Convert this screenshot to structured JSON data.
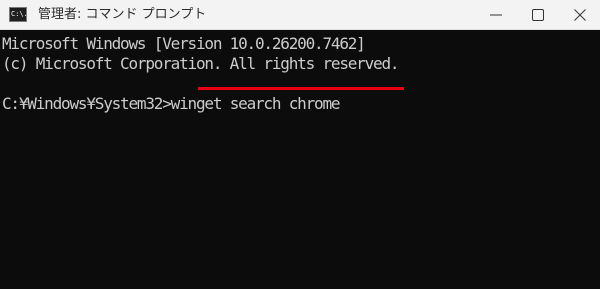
{
  "window": {
    "title": "管理者: コマンド プロンプト",
    "icon_label": "C:\\.",
    "controls": {
      "minimize_icon": "minimize-icon",
      "maximize_icon": "maximize-icon",
      "close_icon": "close-icon"
    }
  },
  "console": {
    "lines": [
      "Microsoft Windows [Version 10.0.26200.7462]",
      "(c) Microsoft Corporation. All rights reserved."
    ],
    "prompt": "C:¥Windows¥System32>",
    "command": "winget search chrome",
    "highlight_color": "#e60012",
    "text_color": "#cccccc",
    "background_color": "#0c0c0c"
  }
}
